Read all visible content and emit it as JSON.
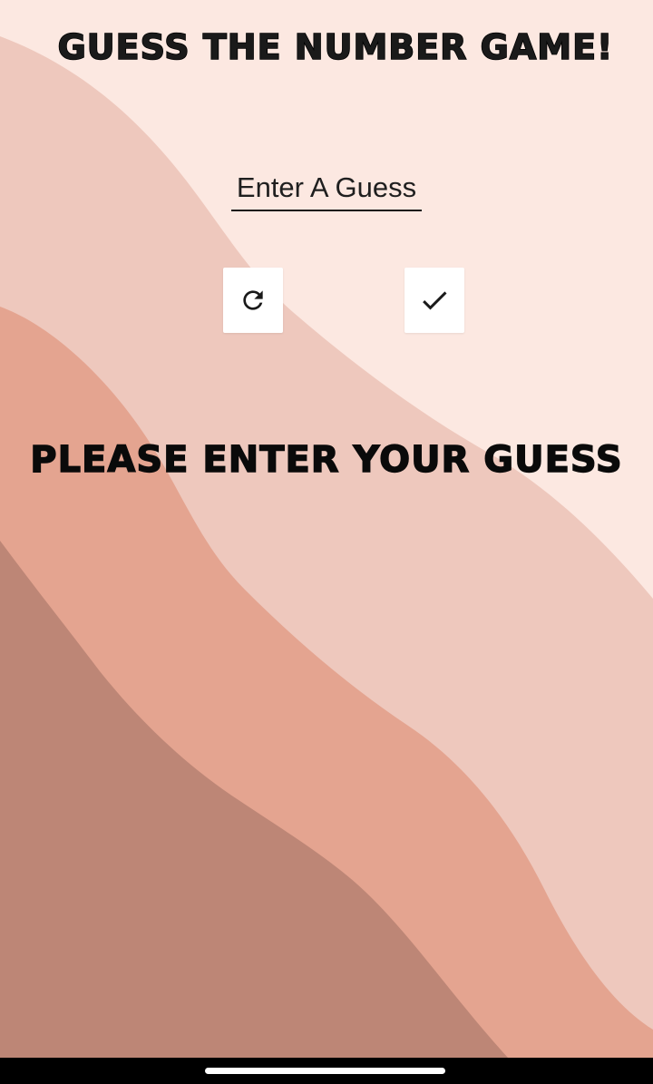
{
  "app": {
    "title": "GUESS THE NUMBER GAME!"
  },
  "input": {
    "placeholder": "Enter A Guess",
    "value": ""
  },
  "buttons": {
    "reset_icon": "refresh-icon",
    "submit_icon": "check-icon"
  },
  "status": {
    "message": "PLEASE ENTER YOUR GUESS"
  },
  "colors": {
    "background": "#fce8e1",
    "wave_light": "#eec8bd",
    "wave_mid": "#e4a490",
    "wave_dark": "#bd8676",
    "text": "#0a0a0a",
    "button_bg": "#ffffff"
  }
}
